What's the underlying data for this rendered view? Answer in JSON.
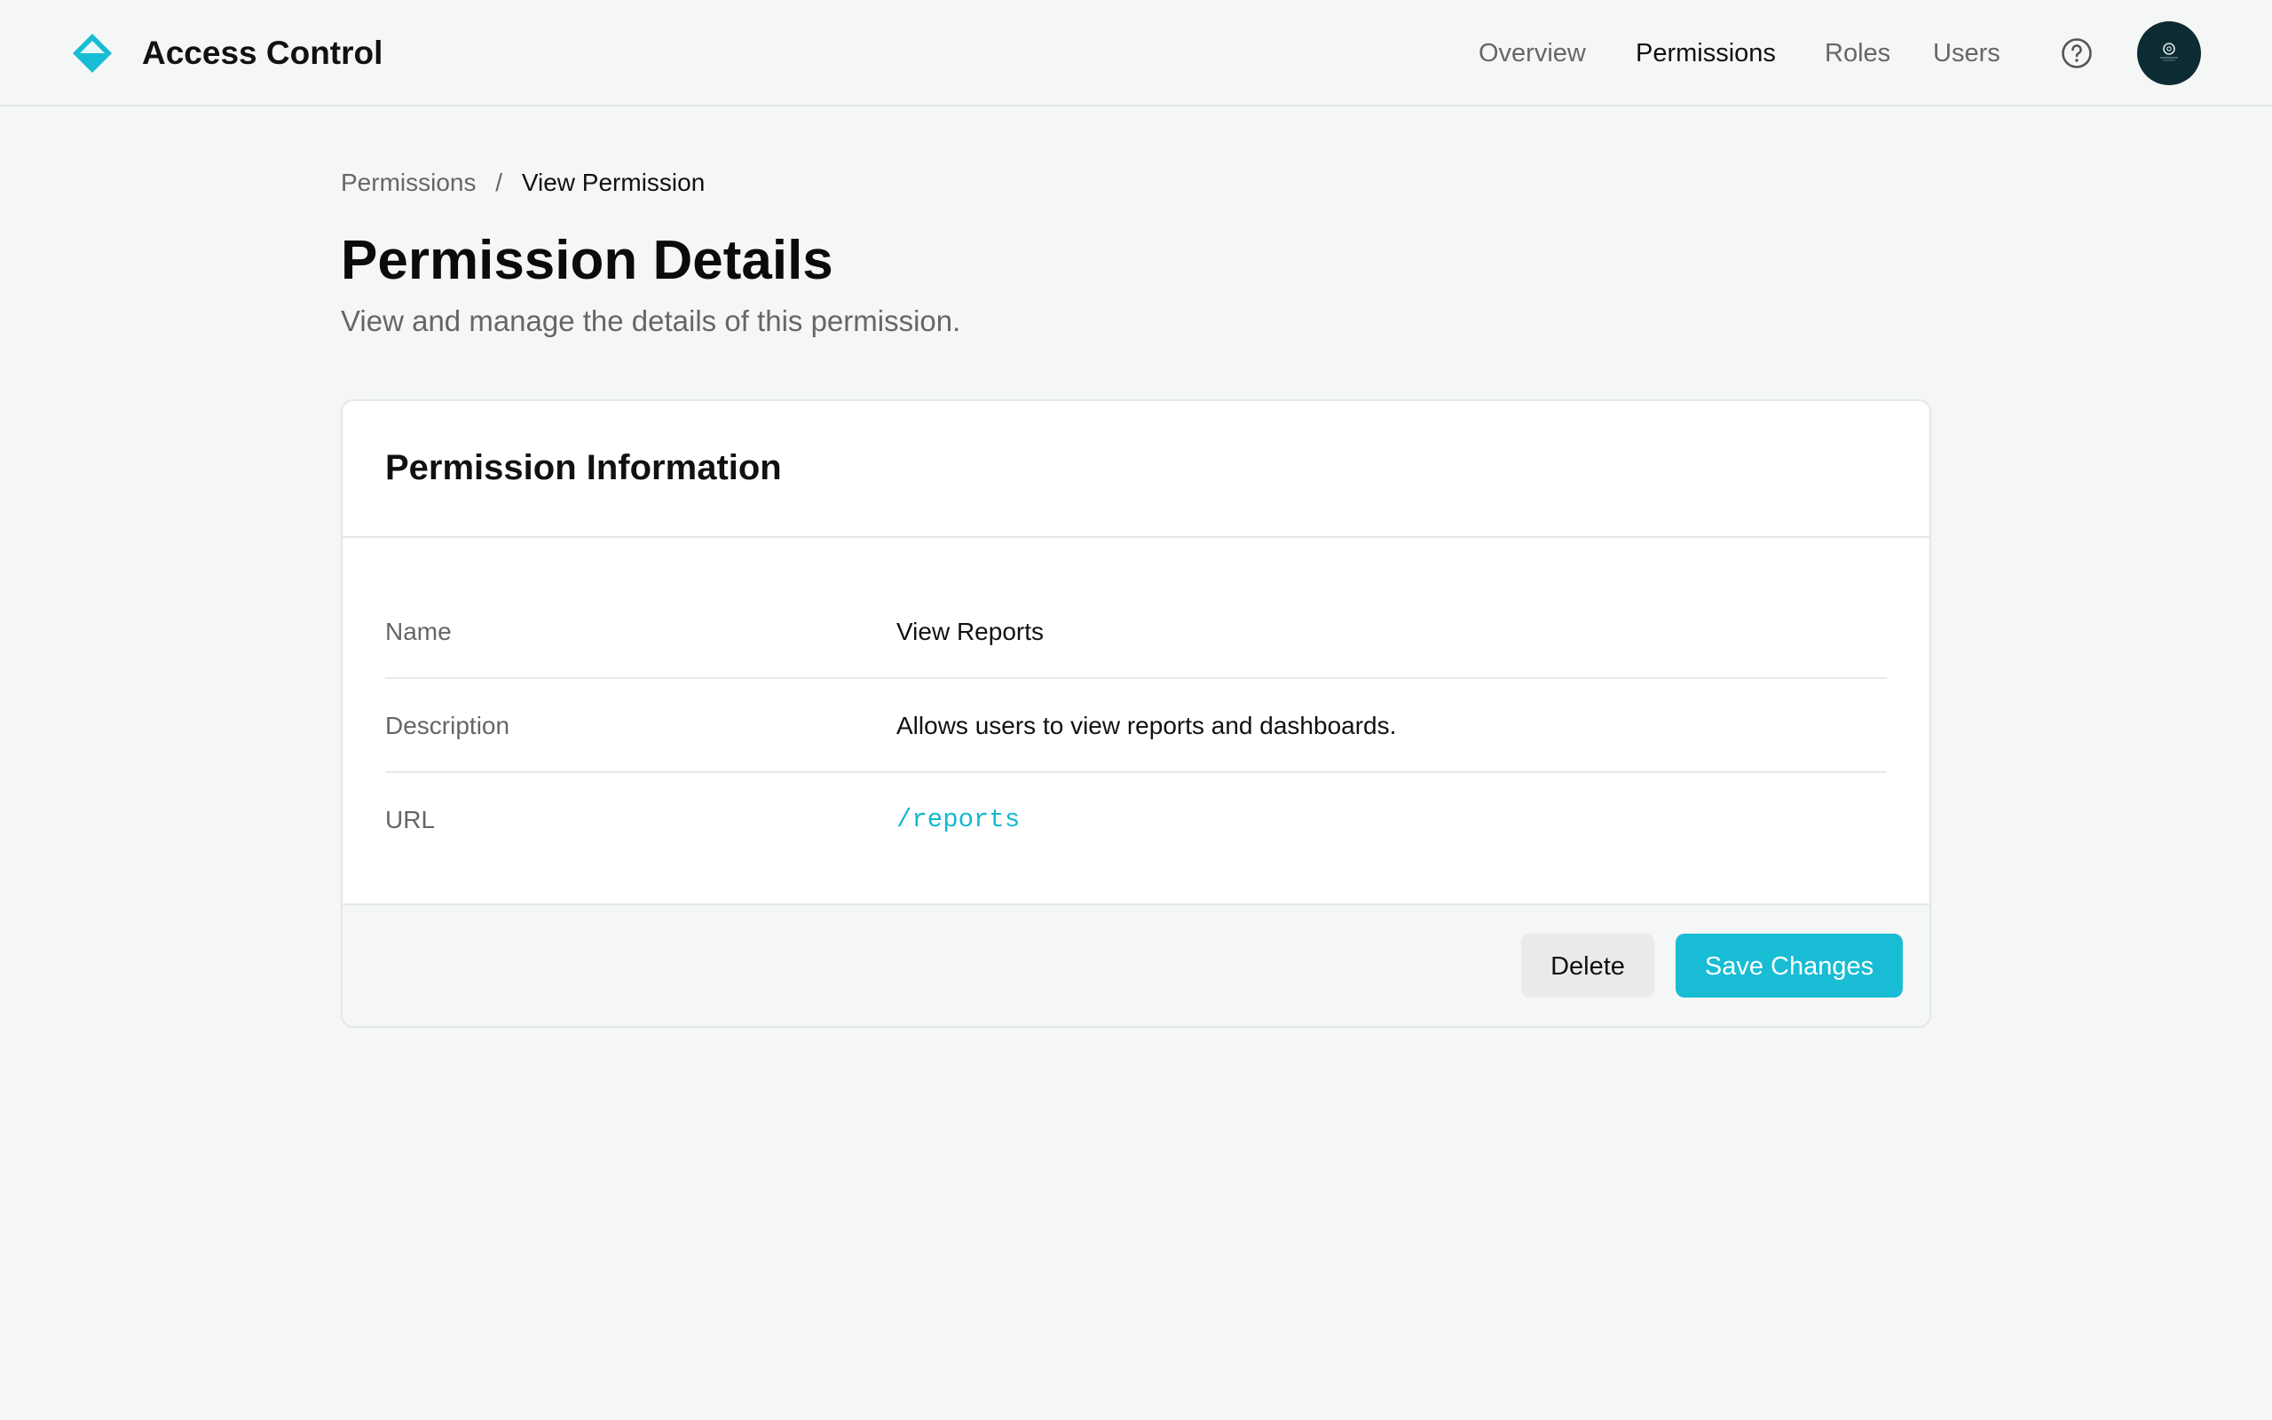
{
  "app": {
    "title": "Access Control",
    "accent_color": "#18bcd4",
    "logo_icon": "diamond-logo-icon"
  },
  "nav": {
    "items": [
      {
        "label": "Overview",
        "active": false
      },
      {
        "label": "Permissions",
        "active": true
      },
      {
        "label": "Roles",
        "active": false
      },
      {
        "label": "Users",
        "active": false
      }
    ],
    "help_icon": "help-circle-icon",
    "avatar_icon": "user-avatar"
  },
  "breadcrumb": {
    "parent": "Permissions",
    "separator": "/",
    "current": "View Permission"
  },
  "page": {
    "title": "Permission Details",
    "subtitle": "View and manage the details of this permission."
  },
  "card": {
    "title": "Permission Information",
    "fields": [
      {
        "label": "Name",
        "value": "View Reports"
      },
      {
        "label": "Description",
        "value": "Allows users to view reports and dashboards."
      },
      {
        "label": "URL",
        "value": "/reports"
      }
    ],
    "actions": {
      "delete_label": "Delete",
      "save_label": "Save Changes"
    }
  }
}
